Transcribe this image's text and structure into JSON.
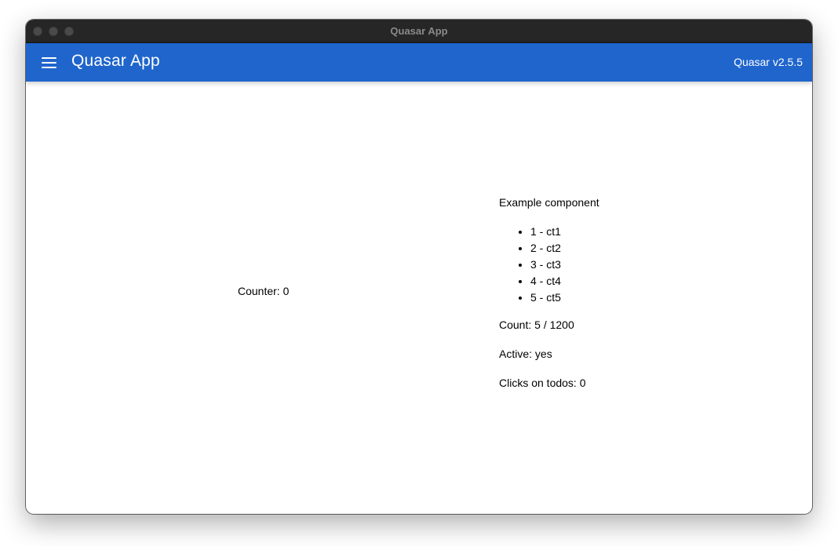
{
  "window": {
    "title": "Quasar App"
  },
  "header": {
    "title": "Quasar App",
    "version": "Quasar v2.5.5",
    "menu_icon": "menu-icon",
    "background": "#1f65cc"
  },
  "main": {
    "counter_text": "Counter: 0",
    "example": {
      "title": "Example component",
      "todos": [
        "1 - ct1",
        "2 - ct2",
        "3 - ct3",
        "4 - ct4",
        "5 - ct5"
      ],
      "count_text": "Count: 5 / 1200",
      "active_text": "Active: yes",
      "clicks_text": "Clicks on todos: 0"
    }
  }
}
